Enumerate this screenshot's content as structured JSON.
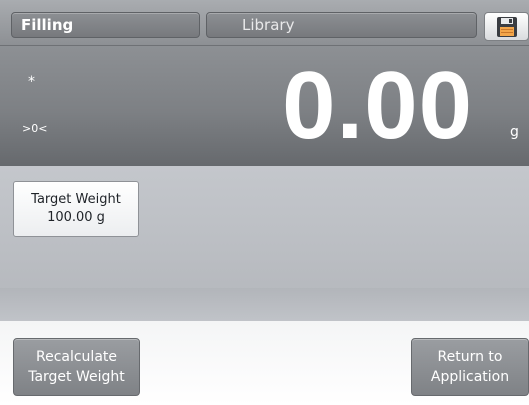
{
  "header": {
    "application_tab": "Filling",
    "library_tab": "Library",
    "save_icon": "floppy-disk-icon"
  },
  "display": {
    "stability_indicator": "*",
    "zero_indicator": ">0<",
    "weight": "0.00",
    "unit": "g"
  },
  "content": {
    "target_weight_label": "Target Weight",
    "target_weight_value": "100.00 g"
  },
  "footer": {
    "recalculate_line1": "Recalculate",
    "recalculate_line2": "Target Weight",
    "return_line1": "Return to",
    "return_line2": "Application"
  },
  "colors": {
    "header_bg": "#8d9094",
    "display_bg": "#7d8084",
    "content_bg": "#c4c7cc",
    "button_light": "#ffffff",
    "button_dark": "#8a8d91",
    "text_light": "#ffffff",
    "text_dark": "#1f2328"
  }
}
